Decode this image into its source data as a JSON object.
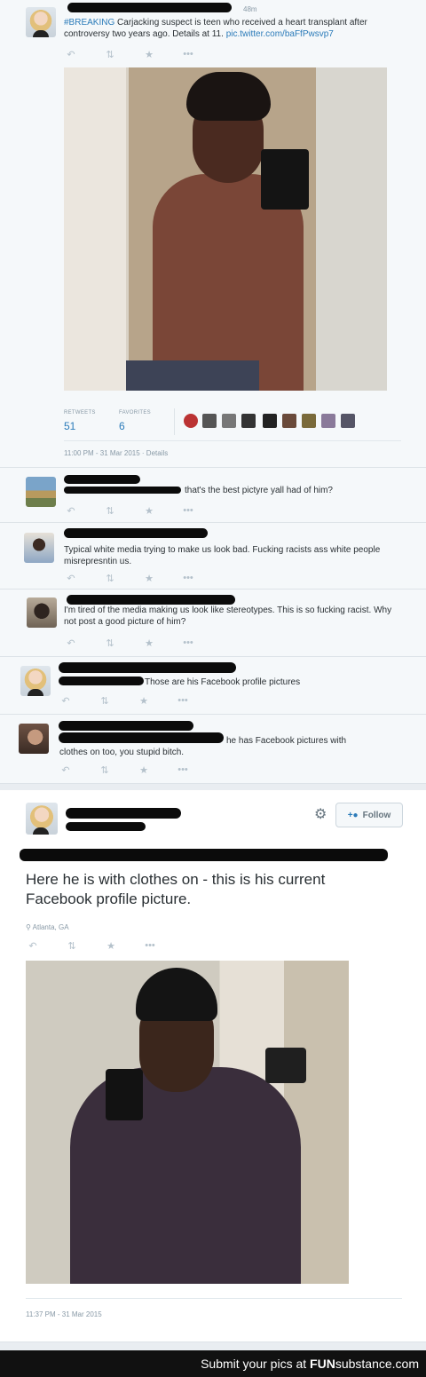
{
  "tweet1": {
    "time": "48m",
    "hashtag": "#BREAKING",
    "text": "Carjacking suspect is teen who received a heart transplant after controversy two years ago. Details at 11.",
    "link": "pic.twitter.com/baFfPwsvp7",
    "retweets_label": "RETWEETS",
    "retweets": "51",
    "favorites_label": "FAVORITES",
    "favorites": "6",
    "timestamp": "11:00 PM - 31 Mar 2015",
    "details": "Details"
  },
  "replies": [
    {
      "text": "that's the best pictyre yall had of him?"
    },
    {
      "text": "Typical white media trying to make us look bad. Fucking racists ass white people misrepresntin us."
    },
    {
      "text": "I'm tired of the media making us look like stereotypes. This is so fucking racist. Why not post a good picture of him?"
    },
    {
      "text": "Those are his Facebook profile pictures"
    },
    {
      "text_a": "he has Facebook pictures with",
      "text_b": "clothes on too, you stupid bitch."
    }
  ],
  "tweet2": {
    "follow_label": "Follow",
    "text": "Here he is with clothes on - this is his current Facebook profile picture.",
    "location": "Atlanta, GA",
    "timestamp": "11:37 PM - 31 Mar 2015"
  },
  "footer": {
    "caption": "Submit your pics at",
    "brand_a": "FUN",
    "brand_b": "substance",
    "brand_c": ".com"
  },
  "icons": [
    "reply-icon",
    "retweet-icon",
    "favorite-icon",
    "more-icon",
    "gear-icon",
    "add-user-icon",
    "location-pin-icon"
  ],
  "colors": {
    "link": "#2b7bb9",
    "card_bg": "#f5f8fa",
    "muted": "#8899a6"
  }
}
